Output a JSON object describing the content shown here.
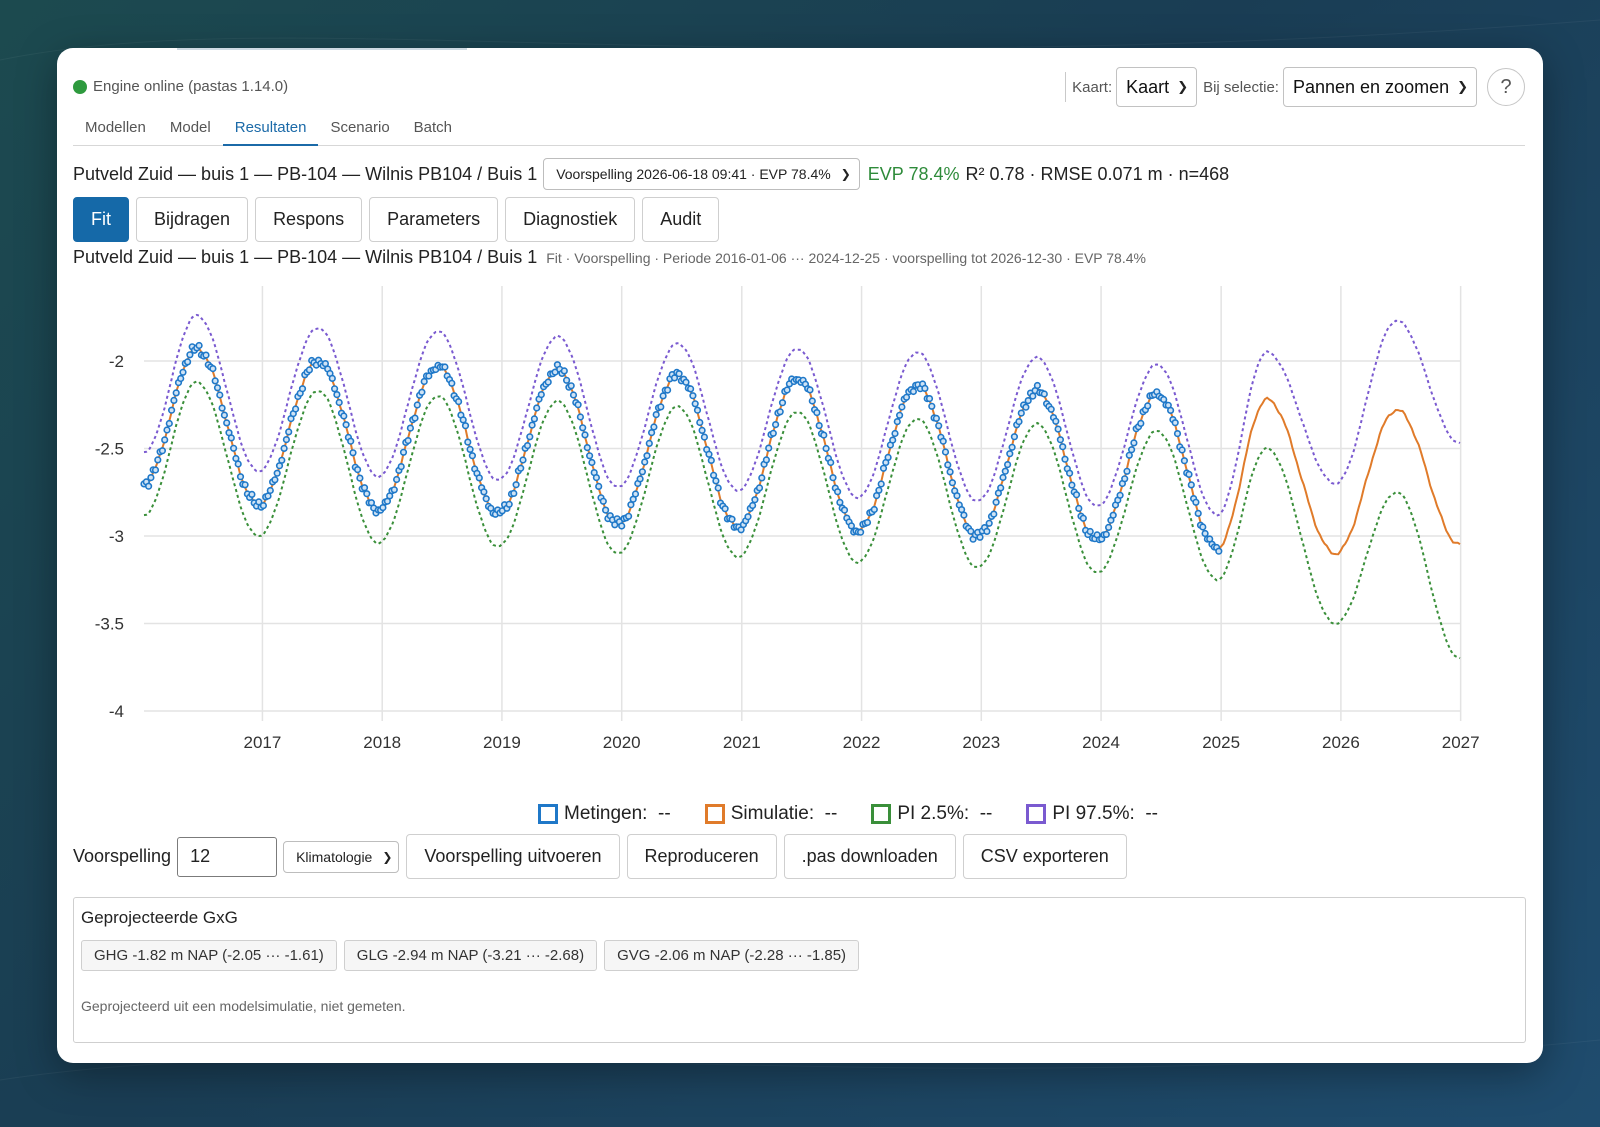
{
  "status": {
    "text": "Engine online (pastas 1.14.0)",
    "color": "#2e9a3e"
  },
  "map_controls": {
    "kaart_label": "Kaart:",
    "kaart_value": "Kaart",
    "selection_label": "Bij selectie:",
    "selection_value": "Pannen en zoomen",
    "help": "?"
  },
  "tabs": [
    "Modellen",
    "Model",
    "Resultaten",
    "Scenario",
    "Batch"
  ],
  "active_tab": "Resultaten",
  "header": {
    "location": "Putveld Zuid — buis 1 — PB-104 — Wilnis PB104 / Buis 1",
    "version_select": "Voorspelling 2026-06-18 09:41 · EVP 78.4%",
    "evp": "EVP 78.4%",
    "stats": "R² 0.78 · RMSE 0.071 m · n=468"
  },
  "view_buttons": [
    "Fit",
    "Bijdragen",
    "Respons",
    "Parameters",
    "Diagnostiek",
    "Audit"
  ],
  "active_view": "Fit",
  "chart_title": {
    "main": "Putveld Zuid — buis 1 — PB-104 — Wilnis PB104 / Buis 1",
    "meta": "Fit · Voorspelling · Periode 2016-01-06 ··· 2024-12-25 · voorspelling tot 2026-12-30 · EVP 78.4%"
  },
  "chart_data": {
    "type": "line",
    "title": "",
    "xlabel": "",
    "ylabel": "",
    "x_range": [
      "2016-01-06",
      "2026-12-30"
    ],
    "xticks": [
      "2017",
      "2018",
      "2019",
      "2020",
      "2021",
      "2022",
      "2023",
      "2024",
      "2025",
      "2026",
      "2027"
    ],
    "ylim": [
      -4,
      -1.6
    ],
    "yticks": [
      "-2",
      "-2.5",
      "-3",
      "-3.5",
      "-4"
    ],
    "grid": true,
    "legend_position": "bottom-center",
    "observation_period": [
      "2016-01-06",
      "2024-12-25"
    ],
    "forecast_until": "2026-12-30",
    "seasonal_extremes": {
      "dates": [
        "2016-01-06",
        "2016-06-15",
        "2016-12-20",
        "2017-06-20",
        "2017-12-20",
        "2018-06-20",
        "2018-12-20",
        "2019-06-20",
        "2019-12-20",
        "2020-06-20",
        "2020-12-20",
        "2021-06-20",
        "2021-12-20",
        "2022-06-20",
        "2022-12-20",
        "2023-06-20",
        "2023-12-20",
        "2024-06-20",
        "2024-12-20",
        "2025-05-20",
        "2025-12-15",
        "2026-06-20",
        "2026-12-30"
      ],
      "simulation": [
        -2.7,
        -1.93,
        -2.82,
        -2.0,
        -2.85,
        -2.03,
        -2.87,
        -2.05,
        -2.93,
        -2.08,
        -2.95,
        -2.1,
        -2.97,
        -2.14,
        -3.0,
        -2.17,
        -3.02,
        -2.19,
        -3.07,
        -2.22,
        -3.1,
        -2.28,
        -3.05
      ],
      "pi_2_5": [
        -2.88,
        -2.12,
        -3.0,
        -2.17,
        -3.04,
        -2.2,
        -3.06,
        -2.23,
        -3.1,
        -2.26,
        -3.12,
        -2.29,
        -3.15,
        -2.33,
        -3.18,
        -2.36,
        -3.21,
        -2.4,
        -3.25,
        -2.5,
        -3.5,
        -2.75,
        -3.7
      ],
      "pi_97_5": [
        -2.52,
        -1.74,
        -2.63,
        -1.81,
        -2.66,
        -1.83,
        -2.68,
        -1.86,
        -2.72,
        -1.9,
        -2.74,
        -1.93,
        -2.78,
        -1.95,
        -2.8,
        -1.98,
        -2.83,
        -2.02,
        -2.88,
        -1.95,
        -2.7,
        -1.77,
        -2.47
      ]
    },
    "series": [
      {
        "name": "Metingen:",
        "color": "#1f78c8",
        "style": "markers"
      },
      {
        "name": "Simulatie:",
        "color": "#e07b2a",
        "style": "solid"
      },
      {
        "name": "PI 2.5%:",
        "color": "#3a8f3a",
        "style": "dotted"
      },
      {
        "name": "PI 97.5%:",
        "color": "#7a5ad0",
        "style": "dotted"
      }
    ],
    "legend_value": "--"
  },
  "forecast": {
    "label": "Voorspelling",
    "value": "12",
    "method": "Klimatologie",
    "buttons": [
      "Voorspelling uitvoeren",
      "Reproduceren",
      ".pas downloaden",
      "CSV exporteren"
    ]
  },
  "gxg": {
    "title": "Geprojecteerde GxG",
    "chips": [
      "GHG -1.82 m NAP (-2.05 ··· -1.61)",
      "GLG -2.94 m NAP (-3.21 ··· -2.68)",
      "GVG -2.06 m NAP (-2.28 ··· -1.85)"
    ],
    "note": "Geprojecteerd uit een modelsimulatie, niet gemeten."
  }
}
